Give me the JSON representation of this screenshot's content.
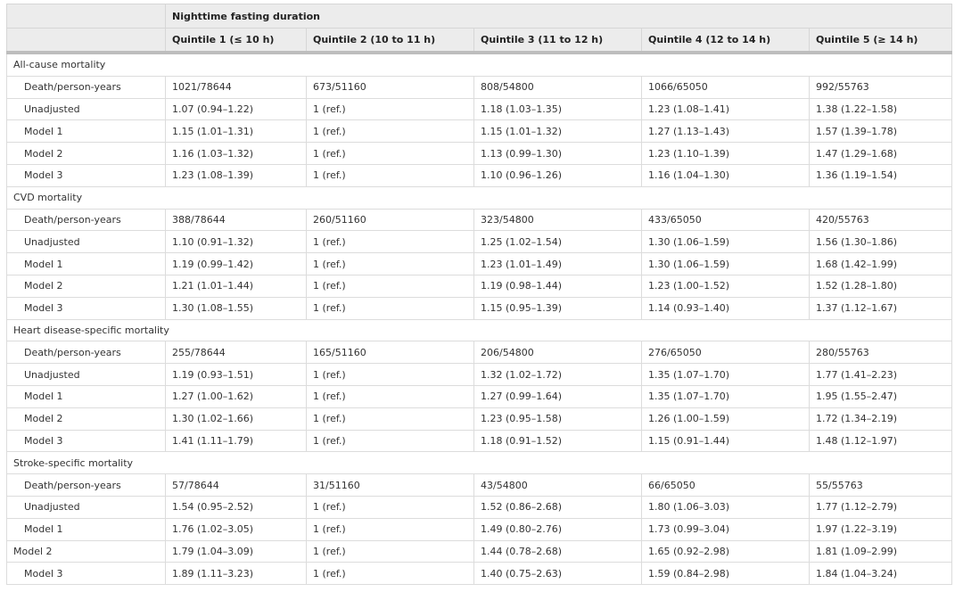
{
  "header": {
    "group_title": "Nighttime fasting duration",
    "columns": [
      "Quintile 1 (≤ 10 h)",
      "Quintile 2 (10 to 11 h)",
      "Quintile 3 (11 to 12 h)",
      "Quintile 4 (12 to 14 h)",
      "Quintile 5 (≥ 14 h)"
    ]
  },
  "sections": [
    {
      "title": "All-cause mortality",
      "rows": [
        {
          "label": "Death/person-years",
          "cells": [
            "1021/78644",
            "673/51160",
            "808/54800",
            "1066/65050",
            "992/55763"
          ]
        },
        {
          "label": "Unadjusted",
          "cells": [
            "1.07 (0.94–1.22)",
            "1 (ref.)",
            "1.18 (1.03–1.35)",
            "1.23 (1.08–1.41)",
            "1.38 (1.22–1.58)"
          ]
        },
        {
          "label": "Model 1",
          "cells": [
            "1.15 (1.01–1.31)",
            "1 (ref.)",
            "1.15 (1.01–1.32)",
            "1.27 (1.13–1.43)",
            "1.57 (1.39–1.78)"
          ]
        },
        {
          "label": "Model 2",
          "cells": [
            "1.16 (1.03–1.32)",
            "1 (ref.)",
            "1.13 (0.99–1.30)",
            "1.23 (1.10–1.39)",
            "1.47 (1.29–1.68)"
          ]
        },
        {
          "label": "Model 3",
          "cells": [
            "1.23 (1.08–1.39)",
            "1 (ref.)",
            "1.10 (0.96–1.26)",
            "1.16 (1.04–1.30)",
            "1.36 (1.19–1.54)"
          ]
        }
      ]
    },
    {
      "title": "CVD mortality",
      "rows": [
        {
          "label": "Death/person-years",
          "cells": [
            "388/78644",
            "260/51160",
            "323/54800",
            "433/65050",
            "420/55763"
          ]
        },
        {
          "label": "Unadjusted",
          "cells": [
            "1.10 (0.91–1.32)",
            "1 (ref.)",
            "1.25 (1.02–1.54)",
            "1.30 (1.06–1.59)",
            "1.56 (1.30–1.86)"
          ]
        },
        {
          "label": "Model 1",
          "cells": [
            "1.19 (0.99–1.42)",
            "1 (ref.)",
            "1.23 (1.01–1.49)",
            "1.30 (1.06–1.59)",
            "1.68 (1.42–1.99)"
          ]
        },
        {
          "label": "Model 2",
          "cells": [
            "1.21 (1.01–1.44)",
            "1 (ref.)",
            "1.19 (0.98–1.44)",
            "1.23 (1.00–1.52)",
            "1.52 (1.28–1.80)"
          ]
        },
        {
          "label": "Model 3",
          "cells": [
            "1.30 (1.08–1.55)",
            "1 (ref.)",
            "1.15 (0.95–1.39)",
            "1.14 (0.93–1.40)",
            "1.37 (1.12–1.67)"
          ]
        }
      ]
    },
    {
      "title": "Heart disease-specific mortality",
      "rows": [
        {
          "label": "Death/person-years",
          "cells": [
            "255/78644",
            "165/51160",
            "206/54800",
            "276/65050",
            "280/55763"
          ]
        },
        {
          "label": "Unadjusted",
          "cells": [
            "1.19 (0.93–1.51)",
            "1 (ref.)",
            "1.32 (1.02–1.72)",
            "1.35 (1.07–1.70)",
            "1.77 (1.41–2.23)"
          ]
        },
        {
          "label": "Model 1",
          "cells": [
            "1.27 (1.00–1.62)",
            "1 (ref.)",
            "1.27 (0.99–1.64)",
            "1.35 (1.07–1.70)",
            "1.95 (1.55–2.47)"
          ]
        },
        {
          "label": "Model 2",
          "cells": [
            "1.30 (1.02–1.66)",
            "1 (ref.)",
            "1.23 (0.95–1.58)",
            "1.26 (1.00–1.59)",
            "1.72 (1.34–2.19)"
          ]
        },
        {
          "label": "Model 3",
          "cells": [
            "1.41 (1.11–1.79)",
            "1 (ref.)",
            "1.18 (0.91–1.52)",
            "1.15 (0.91–1.44)",
            "1.48 (1.12–1.97)"
          ]
        }
      ]
    },
    {
      "title": "Stroke-specific mortality",
      "rows": [
        {
          "label": "Death/person-years",
          "cells": [
            "57/78644",
            "31/51160",
            "43/54800",
            "66/65050",
            "55/55763"
          ]
        },
        {
          "label": "Unadjusted",
          "cells": [
            "1.54 (0.95–2.52)",
            "1 (ref.)",
            "1.52 (0.86–2.68)",
            "1.80 (1.06–3.03)",
            "1.77 (1.12–2.79)"
          ]
        },
        {
          "label": "Model 1",
          "cells": [
            "1.76 (1.02–3.05)",
            "1 (ref.)",
            "1.49 (0.80–2.76)",
            "1.73 (0.99–3.04)",
            "1.97 (1.22–3.19)"
          ]
        },
        {
          "label": "Model 2",
          "flush": true,
          "cells": [
            "1.79 (1.04–3.09)",
            "1 (ref.)",
            "1.44 (0.78–2.68)",
            "1.65 (0.92–2.98)",
            "1.81 (1.09–2.99)"
          ]
        },
        {
          "label": "Model 3",
          "cells": [
            "1.89 (1.11–3.23)",
            "1 (ref.)",
            "1.40 (0.75–2.63)",
            "1.59 (0.84–2.98)",
            "1.84 (1.04–3.24)"
          ]
        }
      ]
    }
  ]
}
